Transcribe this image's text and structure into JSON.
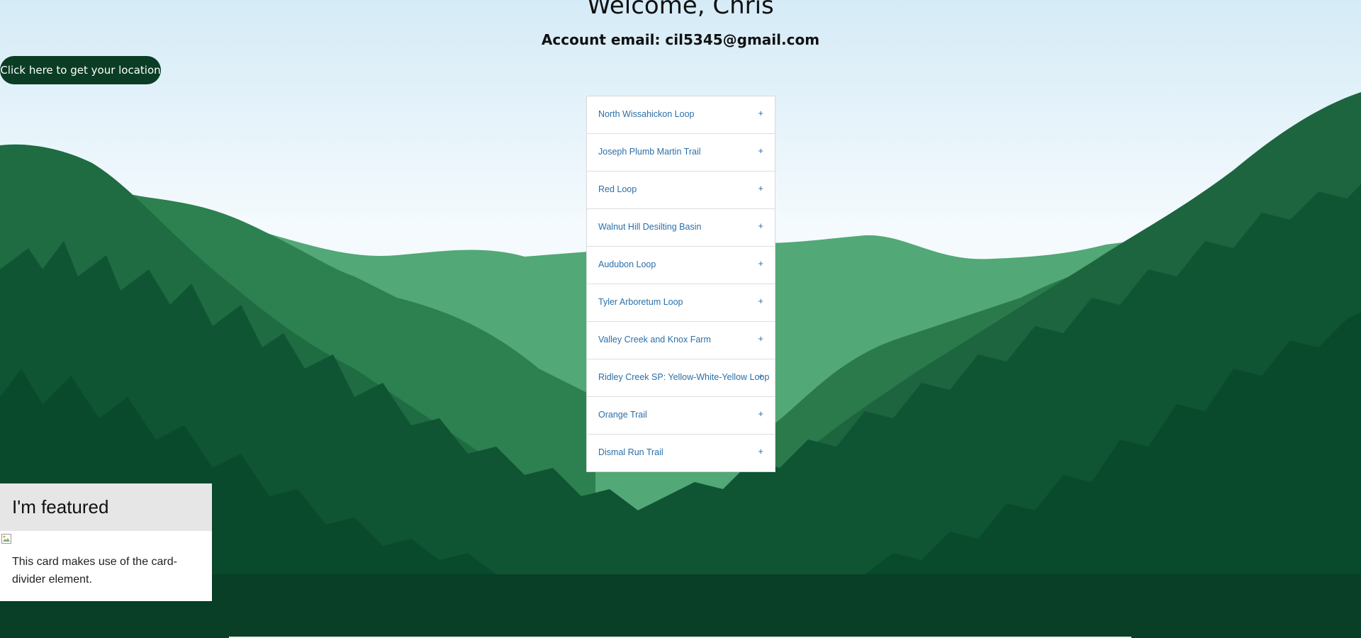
{
  "header": {
    "welcome": "Welcome, Chris",
    "email": "Account email: cil5345@gmail.com"
  },
  "location_button": {
    "label": "Click here to get your location"
  },
  "trails": [
    {
      "name": "North Wissahickon Loop",
      "toggle": "+"
    },
    {
      "name": "Joseph Plumb Martin Trail",
      "toggle": "+"
    },
    {
      "name": "Red Loop",
      "toggle": "+"
    },
    {
      "name": "Walnut Hill Desilting Basin",
      "toggle": "+"
    },
    {
      "name": "Audubon Loop",
      "toggle": "+"
    },
    {
      "name": "Tyler Arboretum Loop",
      "toggle": "+"
    },
    {
      "name": "Valley Creek and Knox Farm",
      "toggle": "+"
    },
    {
      "name": "Ridley Creek SP: Yellow-White-Yellow Loop",
      "toggle": "+"
    },
    {
      "name": "Orange Trail",
      "toggle": "+"
    },
    {
      "name": "Dismal Run Trail",
      "toggle": "+"
    }
  ],
  "card": {
    "title": "I'm featured",
    "text": "This card makes use of the card-divider element."
  },
  "colors": {
    "button_bg": "#0b3d24",
    "link": "#2b6fa8",
    "forest_dark": "#0a4a2c",
    "forest_mid": "#1e6e45",
    "hill_light": "#4fa673"
  }
}
